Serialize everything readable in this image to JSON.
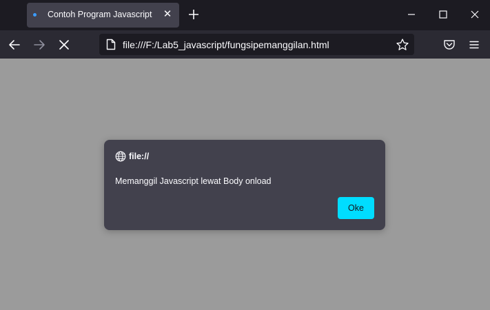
{
  "tab": {
    "title": "Contoh Program Javascript",
    "close_glyph": "✕"
  },
  "icons": {
    "tab_loading": "loading-dot-icon",
    "new_tab": "plus-icon",
    "minimize": "minimize-icon",
    "maximize": "maximize-icon",
    "close": "close-icon",
    "back": "arrow-left-icon",
    "forward": "arrow-right-icon",
    "stop": "stop-x-icon",
    "page": "page-icon",
    "bookmark": "star-icon",
    "pocket": "pocket-icon",
    "menu": "hamburger-menu-icon",
    "origin": "globe-icon"
  },
  "urlbar": {
    "url": "file:///F:/Lab5_javascript/fungsipemanggilan.html"
  },
  "dialog": {
    "origin": "file://",
    "message": "Memanggil Javascript lewat Body onload",
    "ok_label": "Oke"
  },
  "colors": {
    "accent": "#00ddff",
    "tab_loading_dot": "#3b9cff",
    "content_overlay": "#9b9b9b",
    "dialog_bg": "#42414d"
  }
}
